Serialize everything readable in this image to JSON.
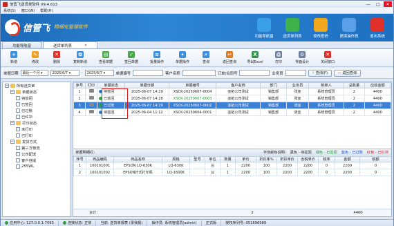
{
  "app": {
    "title": "信管飞送货单软件 V9.4.613"
  },
  "window_buttons": {
    "min": "—",
    "max": "□",
    "close": "✕"
  },
  "menu": [
    "系统(S)",
    "窗口(W)",
    "帮助(H)"
  ],
  "banner": {
    "brand": "信管飞",
    "slogan": "精细化管理软件"
  },
  "top_buttons": [
    {
      "label": "功能导航窗",
      "icon": "navigator-icon",
      "color": "#3aa0e8"
    },
    {
      "label": "送货单列表",
      "icon": "list-icon",
      "color": "#3fb24a"
    },
    {
      "label": "修改密码",
      "icon": "lock-icon",
      "color": "#f2a81d"
    },
    {
      "label": "更换操作员",
      "icon": "user-switch-icon",
      "color": "#5aa0e8"
    },
    {
      "label": "退出系统",
      "icon": "exit-icon",
      "color": "#e0302a"
    }
  ],
  "tabs": [
    {
      "label": "功能导航窗",
      "active": false
    },
    {
      "label": "送货单列表",
      "active": true
    }
  ],
  "toolbar": [
    {
      "label": "新增",
      "color": "#3b8fe0",
      "glyph": "+"
    },
    {
      "label": "修改",
      "color": "#f0a020",
      "glyph": "✎"
    },
    {
      "label": "删除",
      "color": "#e0302a",
      "glyph": "✕"
    },
    {
      "label": "复制新增",
      "color": "#3b8fe0",
      "glyph": "⧉"
    },
    {
      "label": "查看单据",
      "color": "#4aa84a",
      "glyph": "▤"
    },
    {
      "label": "签回单据",
      "color": "#4aa84a",
      "glyph": "✓"
    },
    {
      "label": "批量操作",
      "color": "#3b8fe0",
      "glyph": "≡"
    },
    {
      "label": "单据操作",
      "color": "#3b8fe0",
      "glyph": "▾"
    },
    {
      "label": "查询",
      "color": "#3b8fe0",
      "glyph": "⌕"
    },
    {
      "label": "返回查询",
      "color": "#e07a20",
      "glyph": "↩"
    },
    {
      "label": "导出Excel",
      "color": "#2e9a4a",
      "glyph": "X"
    },
    {
      "label": "打印",
      "color": "#6b7fa0",
      "glyph": "⎙"
    },
    {
      "label": "界面设计",
      "color": "#6b7fa0",
      "glyph": "⚙"
    },
    {
      "label": "关闭窗口",
      "color": "#e0302a",
      "glyph": "✕"
    }
  ],
  "filter": {
    "date_label": "单据日期",
    "range_value": "最近一个月",
    "date_from": "2025/6/7",
    "date_to": "2025/6/7",
    "order_no_label": "单据编号",
    "customer_label": "客户名称",
    "contract_label": "订单/合同号",
    "business_label": "业务员",
    "query_btn": "查询(F)",
    "reset_btn": "返回查询"
  },
  "tree": [
    {
      "label": "所有送货单",
      "level": 0,
      "type": "root"
    },
    {
      "label": "单据状态",
      "level": 1,
      "type": "folder"
    },
    {
      "label": "待签回",
      "level": 2,
      "type": "leaf"
    },
    {
      "label": "已签回",
      "level": 2,
      "type": "leaf"
    },
    {
      "label": "已过账",
      "level": 2,
      "type": "leaf"
    },
    {
      "label": "已红冲",
      "level": 2,
      "type": "leaf"
    },
    {
      "label": "打印状态",
      "level": 1,
      "type": "folder"
    },
    {
      "label": "未打印",
      "level": 2,
      "type": "leaf"
    },
    {
      "label": "已打印",
      "level": 2,
      "type": "leaf"
    },
    {
      "label": "发货方式",
      "level": 1,
      "type": "folder"
    },
    {
      "label": "第三方物流",
      "level": 2,
      "type": "leaf"
    },
    {
      "label": "公司配送",
      "level": 2,
      "type": "leaf"
    },
    {
      "label": "客户自提",
      "level": 2,
      "type": "leaf"
    },
    {
      "label": "255WL",
      "level": 2,
      "type": "leaf"
    }
  ],
  "orders": {
    "columns": [
      "序号",
      "打印",
      "单据状态",
      "单据日期",
      "单据编号",
      "客户名称",
      "部门",
      "业务员",
      "制单人",
      "总数量",
      "应收金额"
    ],
    "rows": [
      {
        "no": "1",
        "status": "待签回",
        "dot": "#2f78d0",
        "date": "2025-06-07 14:29",
        "code": "XSCK-20250607-0004",
        "customer": "亚拓公司测试",
        "dept": "销售部",
        "sales": "张亚",
        "maker": "系统管理员",
        "qty": "2",
        "amount": "4400",
        "selected": false
      },
      {
        "no": "2",
        "status": "已签回",
        "dot": "#2ea043",
        "date": "2025-06-07 14:28",
        "code": "XSCK-20250607-0003",
        "customer": "亚拓公司测试",
        "dept": "销售部",
        "sales": "张亚",
        "maker": "系统管理员",
        "qty": "2",
        "amount": "4400",
        "selected": false
      },
      {
        "no": "3",
        "status": "已过账",
        "dot": "#2ea043",
        "date": "2025-06-07 14:29",
        "code": "XSCK-20250607-0002",
        "customer": "亚拓公司测试",
        "dept": "销售部",
        "sales": "张亚",
        "maker": "系统管理员",
        "qty": "2",
        "amount": "4400",
        "selected": true
      },
      {
        "no": "4",
        "status": "待签回",
        "dot": "#2f78d0",
        "date": "2025-06-04 11:12",
        "code": "XSCK-20250604-0001",
        "customer": "亚拓公司测试",
        "dept": "销售部",
        "sales": "张亚",
        "maker": "系统管理员",
        "qty": "2",
        "amount": "4400",
        "selected": false
      }
    ]
  },
  "detail": {
    "title": "单据明细栏:",
    "legend_prefix": "字体颜色说明:",
    "legend": [
      {
        "label": "黑色 - 待签回",
        "color": "#222222"
      },
      {
        "label": "绿色 - 已签回",
        "color": "#1a9a2a"
      },
      {
        "label": "蓝色 - 已过账",
        "color": "#1a4fd0"
      },
      {
        "label": "红色 - 已红冲",
        "color": "#d01818"
      }
    ],
    "columns": [
      "序号",
      "商品编码",
      "商品名称",
      "规格",
      "型号",
      "单位",
      "数量",
      "单价",
      "折扣率%",
      "折扣单价",
      "含税单价",
      "税率",
      "金额",
      "税额"
    ],
    "rows": [
      {
        "no": "1",
        "code": "100101001",
        "name": "EPSON LQ-630K",
        "spec": "LQ-630K",
        "model": "",
        "unit": "台",
        "qty": "1",
        "price": "2200",
        "disc": "100",
        "dprice": "2200",
        "tprice": "2200",
        "tax": "0",
        "amount": "2200",
        "taxamt": "0"
      },
      {
        "no": "2",
        "code": "100101002",
        "name": "EPSON针式打印机",
        "spec": "LQ-1600K",
        "model": "",
        "unit": "台",
        "qty": "1",
        "price": "2200",
        "disc": "100",
        "dprice": "2200",
        "tprice": "2200",
        "tax": "0",
        "amount": "2200",
        "taxamt": "0"
      }
    ],
    "summary": {
      "label": "合计:",
      "qty": "2",
      "amount": "4400"
    }
  },
  "status": {
    "server": "应用中心: 127.0.0.1:7093",
    "conn": "连接状态: 正常",
    "current": "当前: 送货单报表 (录我报)",
    "operator": "操作员: 系统管理员(admin)",
    "edition": "正式版",
    "license": "授权序列号: 051696989"
  }
}
